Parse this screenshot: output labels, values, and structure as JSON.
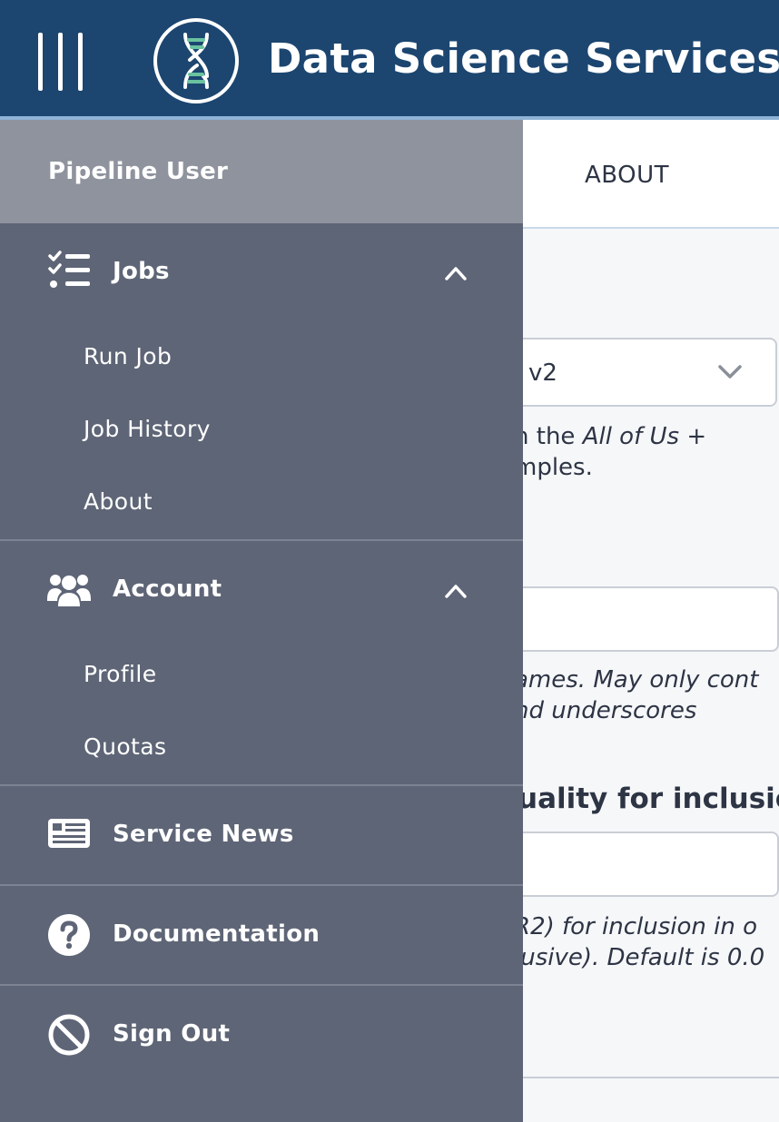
{
  "header": {
    "title": "Data Science Services",
    "menu_icon": "hamburger-menu-icon",
    "logo_icon": "dna-logo-icon"
  },
  "content": {
    "tab_about": "ABOUT",
    "select_value": "v2",
    "help1_line1_pre": "n the ",
    "help1_line1_em": "All of Us",
    "help1_line1_post": " +",
    "help1_line2": "mples.",
    "help2_line1": "ames. May only cont",
    "help2_line2": "nd underscores",
    "label3": "uality for inclusio",
    "help3_line1": "R2) for inclusion in o",
    "help3_line2": "lusive). Default is 0.0"
  },
  "drawer": {
    "user_name": "Pipeline User",
    "jobs": {
      "label": "Jobs",
      "icon": "checklist-icon",
      "items": [
        "Run Job",
        "Job History",
        "About"
      ]
    },
    "account": {
      "label": "Account",
      "icon": "users-icon",
      "items": [
        "Profile",
        "Quotas"
      ]
    },
    "news": {
      "label": "Service News",
      "icon": "newspaper-icon"
    },
    "docs": {
      "label": "Documentation",
      "icon": "question-circle-icon"
    },
    "signout": {
      "label": "Sign Out",
      "icon": "ban-icon"
    }
  },
  "colors": {
    "header_bg": "#1c4670",
    "drawer_bg": "#5e6576",
    "drawer_user_bg": "#8f939d",
    "logo_accent": "#6ac3a0"
  }
}
